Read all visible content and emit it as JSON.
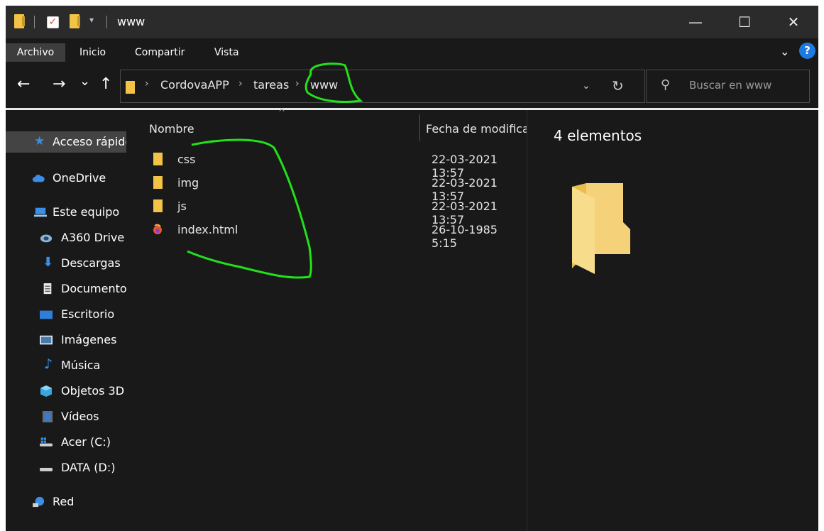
{
  "window": {
    "title": "www",
    "minimize": "—",
    "maximize": "☐",
    "close": "✕"
  },
  "ribbon": {
    "tabs": [
      {
        "label": "Archivo"
      },
      {
        "label": "Inicio"
      },
      {
        "label": "Compartir"
      },
      {
        "label": "Vista"
      }
    ],
    "help": "?"
  },
  "nav": {
    "back": "←",
    "forward": "→",
    "recent": "⌄",
    "up": "↑",
    "breadcrumb": [
      "CordovaAPP",
      "tareas",
      "www"
    ],
    "separator": "›",
    "search_placeholder": "Buscar en www"
  },
  "sidebar": {
    "items": [
      {
        "label": "Acceso rápido",
        "icon": "star-icon"
      },
      {
        "label": "OneDrive",
        "icon": "cloud-icon"
      },
      {
        "label": "Este equipo",
        "icon": "computer-icon"
      },
      {
        "label": "A360 Drive",
        "icon": "a360-drive-icon"
      },
      {
        "label": "Descargas",
        "icon": "download-icon"
      },
      {
        "label": "Documentos",
        "icon": "document-icon"
      },
      {
        "label": "Escritorio",
        "icon": "desktop-icon"
      },
      {
        "label": "Imágenes",
        "icon": "image-icon"
      },
      {
        "label": "Música",
        "icon": "music-icon"
      },
      {
        "label": "Objetos 3D",
        "icon": "cube-icon"
      },
      {
        "label": "Vídeos",
        "icon": "video-icon"
      },
      {
        "label": "Acer (C:)",
        "icon": "drive-windows-icon"
      },
      {
        "label": "DATA (D:)",
        "icon": "drive-icon"
      },
      {
        "label": "Red",
        "icon": "network-icon"
      }
    ]
  },
  "columns": {
    "name": "Nombre",
    "date": "Fecha de modifica"
  },
  "files": [
    {
      "name": "css",
      "date": "22-03-2021 13:57",
      "type": "folder"
    },
    {
      "name": "img",
      "date": "22-03-2021 13:57",
      "type": "folder"
    },
    {
      "name": "js",
      "date": "22-03-2021 13:57",
      "type": "folder"
    },
    {
      "name": "index.html",
      "date": "26-10-1985 5:15",
      "type": "html"
    }
  ],
  "preview": {
    "count": "4 elementos"
  },
  "colors": {
    "background": "#191919",
    "titlebar": "#2b2b2b",
    "folder": "#f3c345",
    "accent": "#1f7ae0",
    "annotation": "#22e01a"
  }
}
